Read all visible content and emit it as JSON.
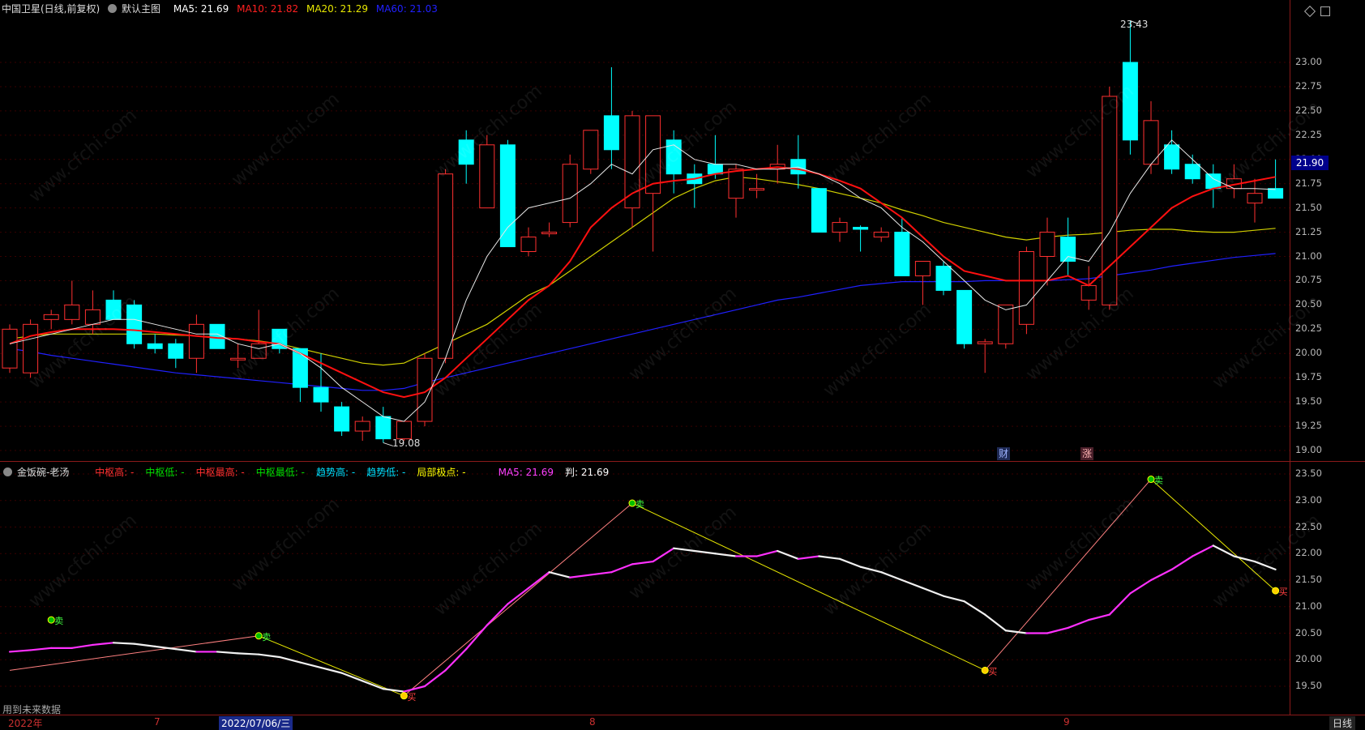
{
  "main_header": {
    "stock_name": "中国卫星(日线,前复权)",
    "template": "默认主图",
    "ma5": "MA5: 21.69",
    "ma10": "MA10: 21.82",
    "ma20": "MA20: 21.29",
    "ma60": "MA60: 21.03"
  },
  "indicator_header": {
    "name": "金饭碗-老汤",
    "items": [
      {
        "label": "中枢高: -",
        "color": "#ff3030"
      },
      {
        "label": "中枢低: -",
        "color": "#00e000"
      },
      {
        "label": "中枢最高: -",
        "color": "#ff3030"
      },
      {
        "label": "中枢最低: -",
        "color": "#00e000"
      },
      {
        "label": "趋势高: -",
        "color": "#00e0ff"
      },
      {
        "label": "趋势低: -",
        "color": "#00e0ff"
      },
      {
        "label": "局部极点: -",
        "color": "#ffff00"
      },
      {
        "label": "MA5: 21.69",
        "color": "#ff40ff"
      },
      {
        "label": "判: 21.69",
        "color": "#ffffff"
      }
    ]
  },
  "colors": {
    "up": "#ff3030",
    "down": "#00ffff",
    "ma5": "#e8e8e8",
    "ma10": "#ff1010",
    "ma20": "#d0d000",
    "ma60": "#2020ff",
    "axis": "#8a1a1a"
  },
  "main_axis": {
    "ticks": [
      "23.00",
      "22.75",
      "22.50",
      "22.25",
      "22.00",
      "21.75",
      "21.50",
      "21.25",
      "21.00",
      "20.75",
      "20.50",
      "20.25",
      "20.00",
      "19.75",
      "19.50",
      "19.25",
      "19.00"
    ],
    "current_price": "21.90"
  },
  "sub_axis": {
    "ticks": [
      "23.50",
      "23.00",
      "22.50",
      "22.00",
      "21.50",
      "21.00",
      "20.50",
      "20.00",
      "19.50"
    ]
  },
  "annotations": {
    "high_label": "23.43",
    "low_label": "19.08",
    "cai": "财",
    "zhang": "涨",
    "future_note": "用到未来数据"
  },
  "dates": {
    "y2022": "2022年",
    "m7": "7",
    "cursor_date": "2022/07/06/三",
    "m8": "8",
    "m9": "9",
    "period": "日线"
  },
  "watermark": "www.cfchi.com",
  "chart_data": {
    "type": "candlestick",
    "ylim": [
      18.95,
      23.55
    ],
    "candles": [
      {
        "o": 19.85,
        "h": 20.3,
        "l": 19.8,
        "c": 20.25
      },
      {
        "o": 19.8,
        "h": 20.35,
        "l": 19.75,
        "c": 20.3
      },
      {
        "o": 20.35,
        "h": 20.45,
        "l": 20.25,
        "c": 20.4
      },
      {
        "o": 20.35,
        "h": 20.75,
        "l": 20.3,
        "c": 20.5
      },
      {
        "o": 20.3,
        "h": 20.65,
        "l": 20.2,
        "c": 20.45
      },
      {
        "o": 20.55,
        "h": 20.65,
        "l": 20.35,
        "c": 20.35
      },
      {
        "o": 20.5,
        "h": 20.55,
        "l": 20.05,
        "c": 20.1
      },
      {
        "o": 20.1,
        "h": 20.2,
        "l": 20.0,
        "c": 20.05
      },
      {
        "o": 20.1,
        "h": 20.15,
        "l": 19.85,
        "c": 19.95
      },
      {
        "o": 19.95,
        "h": 20.4,
        "l": 19.8,
        "c": 20.3
      },
      {
        "o": 20.3,
        "h": 20.3,
        "l": 20.05,
        "c": 20.05
      },
      {
        "o": 19.95,
        "h": 20.1,
        "l": 19.85,
        "c": 19.95
      },
      {
        "o": 19.95,
        "h": 20.45,
        "l": 19.95,
        "c": 20.1
      },
      {
        "o": 20.25,
        "h": 20.25,
        "l": 20.0,
        "c": 20.05
      },
      {
        "o": 20.05,
        "h": 20.05,
        "l": 19.5,
        "c": 19.65
      },
      {
        "o": 19.65,
        "h": 20.0,
        "l": 19.4,
        "c": 19.5
      },
      {
        "o": 19.45,
        "h": 19.5,
        "l": 19.15,
        "c": 19.2
      },
      {
        "o": 19.2,
        "h": 19.35,
        "l": 19.1,
        "c": 19.3
      },
      {
        "o": 19.35,
        "h": 19.45,
        "l": 19.08,
        "c": 19.12
      },
      {
        "o": 19.12,
        "h": 19.3,
        "l": 19.1,
        "c": 19.3
      },
      {
        "o": 19.3,
        "h": 20.0,
        "l": 19.25,
        "c": 19.95
      },
      {
        "o": 19.95,
        "h": 21.9,
        "l": 19.9,
        "c": 21.85
      },
      {
        "o": 22.2,
        "h": 22.3,
        "l": 21.75,
        "c": 21.95
      },
      {
        "o": 21.5,
        "h": 22.25,
        "l": 21.5,
        "c": 22.15
      },
      {
        "o": 22.15,
        "h": 22.2,
        "l": 21.1,
        "c": 21.1
      },
      {
        "o": 21.05,
        "h": 21.3,
        "l": 21.0,
        "c": 21.2
      },
      {
        "o": 21.25,
        "h": 21.35,
        "l": 21.2,
        "c": 21.25
      },
      {
        "o": 21.35,
        "h": 22.05,
        "l": 21.3,
        "c": 21.95
      },
      {
        "o": 21.9,
        "h": 22.3,
        "l": 21.85,
        "c": 22.3
      },
      {
        "o": 22.45,
        "h": 22.95,
        "l": 21.9,
        "c": 22.1
      },
      {
        "o": 21.5,
        "h": 22.5,
        "l": 21.3,
        "c": 22.45
      },
      {
        "o": 21.65,
        "h": 22.45,
        "l": 21.05,
        "c": 22.45
      },
      {
        "o": 22.2,
        "h": 22.3,
        "l": 21.65,
        "c": 21.85
      },
      {
        "o": 21.85,
        "h": 21.95,
        "l": 21.5,
        "c": 21.75
      },
      {
        "o": 21.95,
        "h": 22.25,
        "l": 21.8,
        "c": 21.85
      },
      {
        "o": 21.6,
        "h": 21.95,
        "l": 21.4,
        "c": 21.9
      },
      {
        "o": 21.7,
        "h": 21.85,
        "l": 21.6,
        "c": 21.7
      },
      {
        "o": 21.9,
        "h": 22.15,
        "l": 21.75,
        "c": 21.95
      },
      {
        "o": 22.0,
        "h": 22.25,
        "l": 21.7,
        "c": 21.85
      },
      {
        "o": 21.7,
        "h": 21.7,
        "l": 21.25,
        "c": 21.25
      },
      {
        "o": 21.25,
        "h": 21.4,
        "l": 21.15,
        "c": 21.35
      },
      {
        "o": 21.3,
        "h": 21.32,
        "l": 21.05,
        "c": 21.28
      },
      {
        "o": 21.2,
        "h": 21.3,
        "l": 21.15,
        "c": 21.25
      },
      {
        "o": 21.25,
        "h": 21.4,
        "l": 20.8,
        "c": 20.8
      },
      {
        "o": 20.8,
        "h": 20.95,
        "l": 20.5,
        "c": 20.95
      },
      {
        "o": 20.9,
        "h": 20.95,
        "l": 20.6,
        "c": 20.65
      },
      {
        "o": 20.65,
        "h": 20.65,
        "l": 20.05,
        "c": 20.1
      },
      {
        "o": 20.1,
        "h": 20.15,
        "l": 19.8,
        "c": 20.12
      },
      {
        "o": 20.1,
        "h": 20.5,
        "l": 20.05,
        "c": 20.5
      },
      {
        "o": 20.3,
        "h": 21.1,
        "l": 20.2,
        "c": 21.05
      },
      {
        "o": 21.0,
        "h": 21.4,
        "l": 20.7,
        "c": 21.25
      },
      {
        "o": 21.2,
        "h": 21.4,
        "l": 20.8,
        "c": 20.95
      },
      {
        "o": 20.55,
        "h": 20.9,
        "l": 20.45,
        "c": 20.7
      },
      {
        "o": 20.5,
        "h": 22.75,
        "l": 20.45,
        "c": 22.65
      },
      {
        "o": 23.0,
        "h": 23.43,
        "l": 22.05,
        "c": 22.2
      },
      {
        "o": 21.95,
        "h": 22.6,
        "l": 21.85,
        "c": 22.4
      },
      {
        "o": 22.15,
        "h": 22.3,
        "l": 21.85,
        "c": 21.9
      },
      {
        "o": 21.95,
        "h": 22.05,
        "l": 21.75,
        "c": 21.8
      },
      {
        "o": 21.85,
        "h": 21.95,
        "l": 21.5,
        "c": 21.7
      },
      {
        "o": 21.7,
        "h": 21.95,
        "l": 21.6,
        "c": 21.8
      },
      {
        "o": 21.55,
        "h": 21.8,
        "l": 21.35,
        "c": 21.65
      },
      {
        "o": 21.7,
        "h": 22.0,
        "l": 21.6,
        "c": 21.6
      }
    ],
    "ma5": [
      20.1,
      20.15,
      20.2,
      20.25,
      20.3,
      20.35,
      20.35,
      20.3,
      20.25,
      20.2,
      20.2,
      20.1,
      20.05,
      20.1,
      20.0,
      19.85,
      19.65,
      19.5,
      19.35,
      19.3,
      19.5,
      19.95,
      20.55,
      21.0,
      21.3,
      21.5,
      21.55,
      21.6,
      21.75,
      21.95,
      21.85,
      22.1,
      22.15,
      22.0,
      21.95,
      21.95,
      21.9,
      21.9,
      21.92,
      21.85,
      21.75,
      21.6,
      21.5,
      21.3,
      21.15,
      20.95,
      20.75,
      20.55,
      20.45,
      20.5,
      20.75,
      21.0,
      20.95,
      21.25,
      21.65,
      21.95,
      22.2,
      22.0,
      21.8,
      21.7,
      21.7,
      21.69
    ],
    "ma10": [
      20.1,
      20.18,
      20.22,
      20.25,
      20.25,
      20.25,
      20.24,
      20.22,
      20.2,
      20.18,
      20.16,
      20.15,
      20.12,
      20.1,
      20.0,
      19.9,
      19.8,
      19.7,
      19.6,
      19.55,
      19.6,
      19.75,
      19.95,
      20.15,
      20.35,
      20.55,
      20.7,
      20.95,
      21.3,
      21.5,
      21.65,
      21.75,
      21.78,
      21.8,
      21.85,
      21.88,
      21.9,
      21.92,
      21.9,
      21.85,
      21.78,
      21.7,
      21.55,
      21.4,
      21.2,
      21.0,
      20.85,
      20.8,
      20.75,
      20.75,
      20.75,
      20.8,
      20.7,
      20.9,
      21.1,
      21.3,
      21.5,
      21.62,
      21.7,
      21.74,
      21.78,
      21.82
    ],
    "ma20": [
      20.15,
      20.18,
      20.2,
      20.2,
      20.2,
      20.2,
      20.2,
      20.2,
      20.19,
      20.18,
      20.17,
      20.15,
      20.13,
      20.1,
      20.05,
      20.0,
      19.95,
      19.9,
      19.88,
      19.9,
      20.0,
      20.1,
      20.2,
      20.3,
      20.45,
      20.6,
      20.7,
      20.85,
      21.0,
      21.15,
      21.3,
      21.45,
      21.6,
      21.7,
      21.78,
      21.82,
      21.8,
      21.77,
      21.74,
      21.7,
      21.65,
      21.6,
      21.55,
      21.48,
      21.42,
      21.35,
      21.3,
      21.25,
      21.2,
      21.17,
      21.2,
      21.22,
      21.23,
      21.25,
      21.27,
      21.28,
      21.28,
      21.26,
      21.25,
      21.25,
      21.27,
      21.29
    ],
    "ma60": [
      20.05,
      20.02,
      19.98,
      19.95,
      19.92,
      19.89,
      19.86,
      19.83,
      19.8,
      19.78,
      19.76,
      19.74,
      19.72,
      19.7,
      19.68,
      19.66,
      19.64,
      19.62,
      19.62,
      19.64,
      19.7,
      19.75,
      19.8,
      19.85,
      19.9,
      19.95,
      20.0,
      20.05,
      20.1,
      20.15,
      20.2,
      20.25,
      20.3,
      20.35,
      20.4,
      20.45,
      20.5,
      20.55,
      20.58,
      20.62,
      20.66,
      20.7,
      20.72,
      20.74,
      20.74,
      20.74,
      20.74,
      20.75,
      20.75,
      20.75,
      20.75,
      20.76,
      20.77,
      20.8,
      20.83,
      20.86,
      20.9,
      20.93,
      20.96,
      20.99,
      21.01,
      21.03
    ],
    "sub_line": [
      20.15,
      20.18,
      20.22,
      20.22,
      20.28,
      20.32,
      20.3,
      20.25,
      20.2,
      20.15,
      20.15,
      20.12,
      20.1,
      20.05,
      19.95,
      19.85,
      19.75,
      19.6,
      19.45,
      19.4,
      19.5,
      19.8,
      20.2,
      20.65,
      21.05,
      21.35,
      21.65,
      21.55,
      21.6,
      21.65,
      21.8,
      21.85,
      22.1,
      22.05,
      22.0,
      21.95,
      21.95,
      22.05,
      21.9,
      21.95,
      21.9,
      21.75,
      21.65,
      21.5,
      21.35,
      21.2,
      21.1,
      20.85,
      20.55,
      20.5,
      20.5,
      20.6,
      20.75,
      20.85,
      21.25,
      21.5,
      21.7,
      21.95,
      22.15,
      21.95,
      21.85,
      21.7
    ],
    "zigzag": [
      {
        "i": 0,
        "v": 19.8
      },
      {
        "i": 12,
        "v": 20.45,
        "t": "卖"
      },
      {
        "i": 19,
        "v": 19.32,
        "t": "买"
      },
      {
        "i": 30,
        "v": 22.95,
        "t": "卖"
      },
      {
        "i": 47,
        "v": 19.8,
        "t": "买"
      },
      {
        "i": 55,
        "v": 23.4,
        "t": "卖"
      },
      {
        "i": 61,
        "v": 21.3,
        "t": "买"
      }
    ],
    "lone_marker": {
      "i": 2,
      "v": 20.75,
      "t": "卖"
    }
  }
}
